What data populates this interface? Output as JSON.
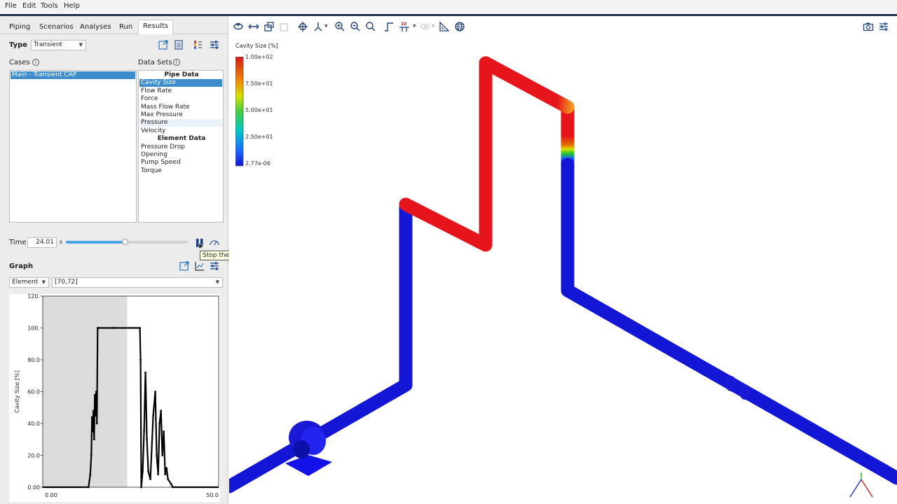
{
  "menu": [
    "File",
    "Edit",
    "Tools",
    "Help"
  ],
  "tabs": [
    {
      "label": "Piping",
      "active": false
    },
    {
      "label": "Scenarios",
      "active": false
    },
    {
      "label": "Analyses",
      "active": false
    },
    {
      "label": "Run",
      "active": false
    },
    {
      "label": "Results",
      "active": true
    }
  ],
  "results": {
    "type_label": "Type",
    "type_value": "Transient",
    "cases_label": "Cases",
    "datasets_label": "Data Sets",
    "cases": [
      "Main - Transient CAP"
    ],
    "datasets": [
      {
        "label": "Pipe Data",
        "header": true
      },
      {
        "label": "Cavity Size",
        "selected": true
      },
      {
        "label": "Flow Rate"
      },
      {
        "label": "Force"
      },
      {
        "label": "Mass Flow Rate"
      },
      {
        "label": "Max Pressure"
      },
      {
        "label": "Pressure",
        "hover": true
      },
      {
        "label": "Velocity"
      },
      {
        "label": "Element Data",
        "header": true
      },
      {
        "label": "Pressure Drop"
      },
      {
        "label": "Opening"
      },
      {
        "label": "Pump Speed"
      },
      {
        "label": "Torque"
      }
    ],
    "time_label": "Time",
    "time_value": "24.01",
    "time_unit": "s",
    "time_progress": 0.48,
    "tooltip": "Stop the animation"
  },
  "graph": {
    "title": "Graph",
    "element_combo": "Element",
    "element_value": "[70,72]"
  },
  "chart_data": {
    "type": "line",
    "title": "",
    "xlabel": "",
    "ylabel": "Cavity Size [%]",
    "xlim": [
      0,
      50
    ],
    "ylim": [
      0,
      120
    ],
    "xticks": [
      "0.00",
      "50.0"
    ],
    "yticks": [
      "0.00",
      "20.0",
      "40.0",
      "60.0",
      "80.0",
      "100.",
      "120."
    ],
    "shaded_until_x": 24.01,
    "series": [
      {
        "values": [
          [
            0,
            0
          ],
          [
            13.0,
            0
          ],
          [
            13.5,
            8
          ],
          [
            13.8,
            20
          ],
          [
            14.0,
            44
          ],
          [
            14.2,
            35
          ],
          [
            14.4,
            48
          ],
          [
            14.6,
            30
          ],
          [
            14.8,
            58
          ],
          [
            15.0,
            45
          ],
          [
            15.2,
            60
          ],
          [
            15.4,
            40
          ],
          [
            15.6,
            100
          ],
          [
            16.0,
            100
          ],
          [
            20.0,
            100
          ],
          [
            27.6,
            100
          ],
          [
            27.8,
            80
          ],
          [
            28.0,
            0
          ],
          [
            28.4,
            10
          ],
          [
            28.8,
            35
          ],
          [
            29.2,
            72
          ],
          [
            29.6,
            30
          ],
          [
            30.0,
            10
          ],
          [
            30.6,
            5
          ],
          [
            31.4,
            45
          ],
          [
            32.0,
            60
          ],
          [
            32.4,
            20
          ],
          [
            32.8,
            8
          ],
          [
            33.2,
            40
          ],
          [
            33.6,
            48
          ],
          [
            34.0,
            20
          ],
          [
            34.4,
            35
          ],
          [
            34.8,
            8
          ],
          [
            35.2,
            12
          ],
          [
            35.6,
            5
          ],
          [
            36.5,
            2
          ],
          [
            37,
            0
          ],
          [
            50,
            0
          ]
        ]
      }
    ]
  },
  "legend": {
    "title": "Cavity Size [%]",
    "ticks": [
      "1.00e+02",
      "7.50e+01",
      "5.00e+01",
      "2.50e+01",
      "2.77e-06"
    ]
  },
  "colors": {
    "accent": "#3d8dcc",
    "pipe_full": "#e5151b",
    "pipe_empty": "#1416d6"
  }
}
